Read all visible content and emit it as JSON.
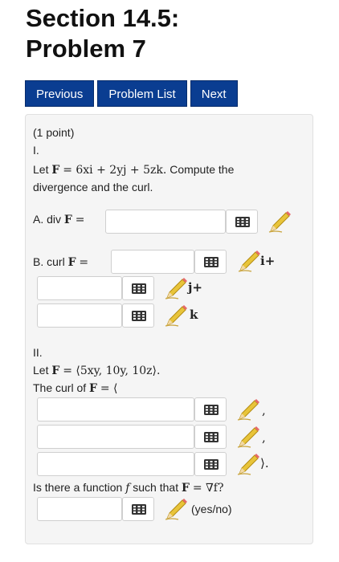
{
  "header": {
    "title_line1": "Section 14.5:",
    "title_line2": "Problem 7"
  },
  "nav": {
    "previous": "Previous",
    "problem_list": "Problem List",
    "next": "Next"
  },
  "problem": {
    "points": "(1 point)",
    "part1": {
      "label": "I.",
      "let": "Let",
      "F": "F",
      "eq_rhs": "= 6xi + 2yj + 5zk.",
      "instruction_1": " Compute the",
      "instruction_2": "divergence and the curl.",
      "div_label": "A. div",
      "div_eq": "=",
      "curl_label": "B. curl",
      "curl_eq": "=",
      "suffix_i": "i+",
      "suffix_j": "j+",
      "suffix_k": "k"
    },
    "part2": {
      "label": "II.",
      "let": "Let",
      "F": "F",
      "eq_rhs": "= ⟨5xy, 10y, 10z⟩.",
      "curl_label": "The curl of",
      "curl_eq": "= ⟨",
      "comma1": ",",
      "comma2": ",",
      "close": "⟩.",
      "question_1": "Is there a function",
      "f": "f",
      "question_2": "such that",
      "question_eq": "= ∇f?",
      "yesno": "(yes/no)"
    }
  },
  "icons": {
    "keyboard": "keypad-icon",
    "pencil": "pencil-icon"
  }
}
